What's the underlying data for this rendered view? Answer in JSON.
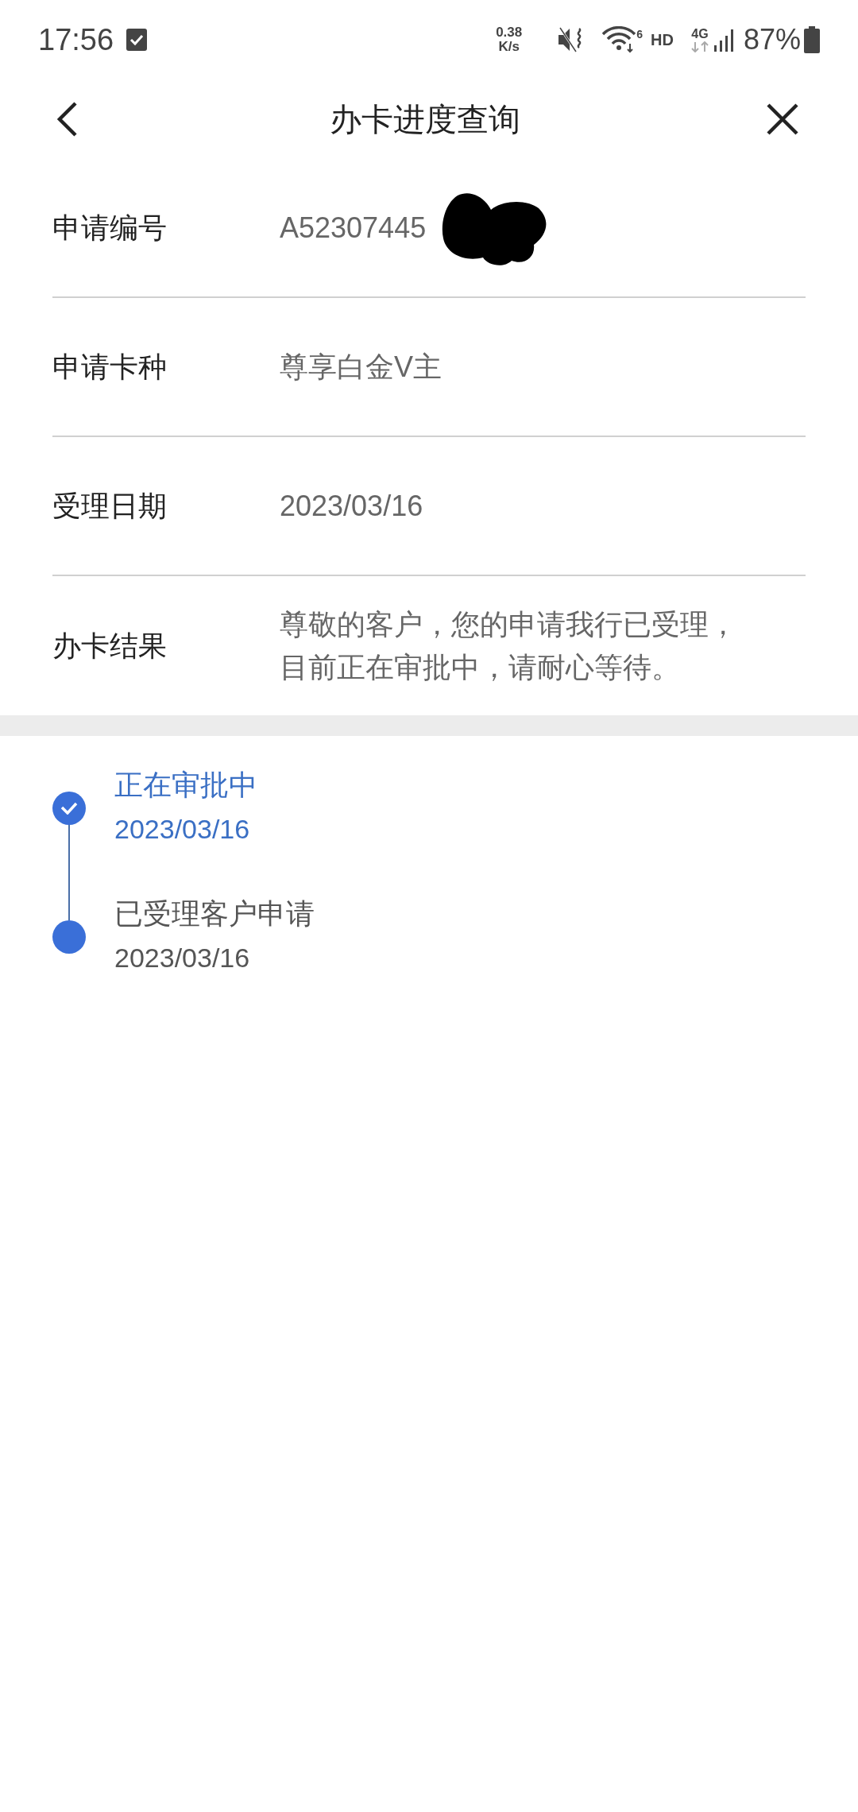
{
  "status_bar": {
    "time": "17:56",
    "net_speed": [
      "0.38",
      "K/s"
    ],
    "wifi_badge": "6",
    "hd": "HD",
    "network": "4G",
    "battery": "87%"
  },
  "header": {
    "title": "办卡进度查询"
  },
  "details": [
    {
      "label": "申请编号",
      "value": "A52307445",
      "redacted": true
    },
    {
      "label": "申请卡种",
      "value": "尊享白金V主",
      "redacted": false
    },
    {
      "label": "受理日期",
      "value": "2023/03/16",
      "redacted": false
    },
    {
      "label": "办卡结果",
      "value": "尊敬的客户，您的申请我行已受理，目前正在审批中，请耐心等待。",
      "redacted": false
    }
  ],
  "timeline": [
    {
      "title": "正在审批中",
      "date": "2023/03/16",
      "current": true
    },
    {
      "title": "已受理客户申请",
      "date": "2023/03/16",
      "current": false
    }
  ]
}
